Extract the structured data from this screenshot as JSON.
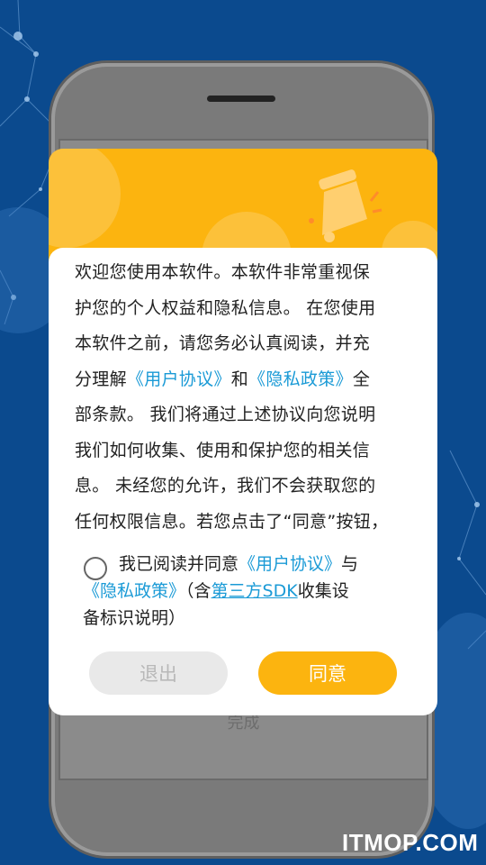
{
  "dialog": {
    "terms_lines": [
      {
        "text": "欢迎您使用本软件。本软件非常重视保"
      },
      {
        "text": "护您的个人权益和隐私信息。 在您使用"
      },
      {
        "text": "本软件之前，请您务必认真阅读，并充"
      },
      {
        "pre": "分理解",
        "link1": "《用户协议》",
        "mid": "和",
        "link2": "《隐私政策》",
        "post": "全"
      },
      {
        "text": "部条款。 我们将通过上述协议向您说明"
      },
      {
        "text": "我们如何收集、使用和保护您的相关信"
      },
      {
        "text": "息。 未经您的允许，我们不会获取您的"
      },
      {
        "text": "任何权限信息。若您点击了“同意”按钮，"
      }
    ],
    "consent": {
      "line1_pre": "我已阅读并同意",
      "line1_link": "《用户协议》",
      "line1_post": "与",
      "line2_link": "《隐私政策》",
      "line2_mid": "（含",
      "line2_ulink": "第三方SDK",
      "line2_post": "收集设",
      "line3": "备标识说明）"
    },
    "buttons": {
      "exit_label": "退出",
      "agree_label": "同意"
    }
  },
  "background": {
    "screen_text": "完成"
  },
  "watermark": "ITMOP.COM",
  "colors": {
    "accent": "#fcb40f",
    "link": "#1a9ad6",
    "background": "#0b4a8e"
  }
}
